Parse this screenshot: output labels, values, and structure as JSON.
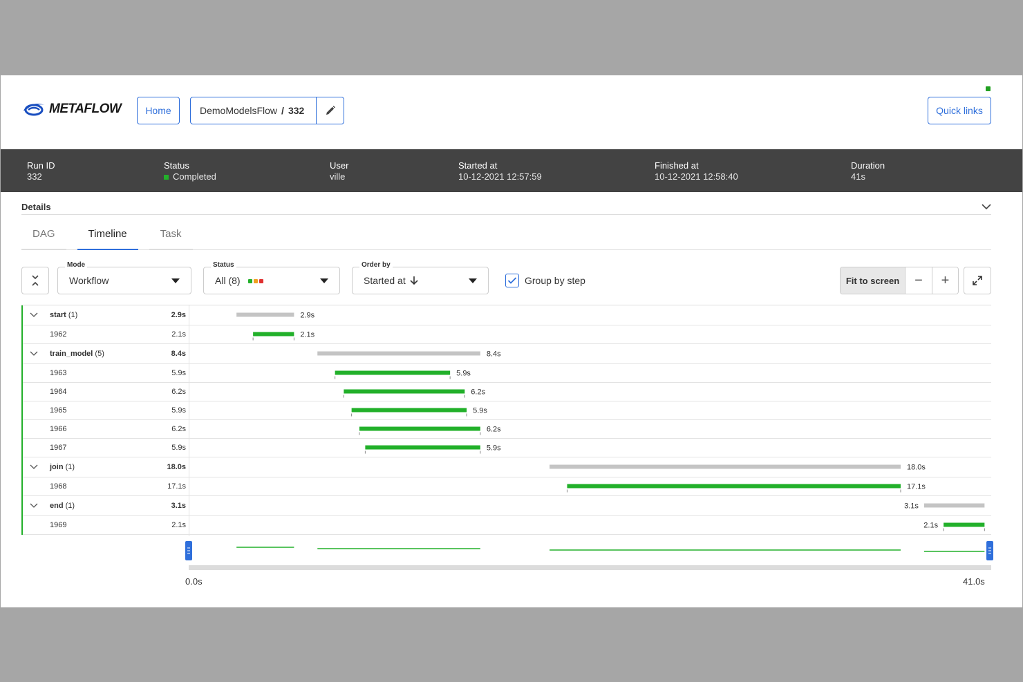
{
  "header": {
    "logo_text": "METAFLOW",
    "home_label": "Home",
    "flow_name": "DemoModelsFlow",
    "separator": "/",
    "run_number": "332",
    "quick_links_label": "Quick links"
  },
  "summary": {
    "run_id_label": "Run ID",
    "run_id": "332",
    "status_label": "Status",
    "status": "Completed",
    "user_label": "User",
    "user": "ville",
    "started_label": "Started at",
    "started": "10-12-2021 12:57:59",
    "finished_label": "Finished at",
    "finished": "10-12-2021 12:58:40",
    "duration_label": "Duration",
    "duration": "41s"
  },
  "details_label": "Details",
  "tabs": [
    {
      "label": "DAG",
      "active": false
    },
    {
      "label": "Timeline",
      "active": true
    },
    {
      "label": "Task",
      "active": false
    }
  ],
  "controls": {
    "mode_label": "Mode",
    "mode_value": "Workflow",
    "status_label": "Status",
    "status_value": "All (8)",
    "status_colors": [
      "#22b02a",
      "#f0a020",
      "#e03030"
    ],
    "order_label": "Order by",
    "order_value": "Started at",
    "group_by_label": "Group by step",
    "group_by_checked": true,
    "fit_label": "Fit to screen",
    "zoom_out": "−",
    "zoom_in": "+"
  },
  "colors": {
    "success": "#22b02a",
    "step_bar": "#c4c4c4",
    "accent": "#2f6fdb"
  },
  "timeline": {
    "total": 41.0,
    "min_label": "0.0s",
    "max_label": "41.0s",
    "rows": [
      {
        "type": "step",
        "name": "start",
        "count": "(1)",
        "duration": "2.9s",
        "start": 2.45,
        "end": 5.4,
        "label": "2.9s",
        "label_side": "right"
      },
      {
        "type": "task",
        "name": "1962",
        "duration": "2.1s",
        "start": 3.3,
        "end": 5.4,
        "label": "2.1s",
        "label_side": "right"
      },
      {
        "type": "step",
        "name": "train_model",
        "count": "(5)",
        "duration": "8.4s",
        "start": 6.6,
        "end": 14.95,
        "label": "8.4s",
        "label_side": "right"
      },
      {
        "type": "task",
        "name": "1963",
        "duration": "5.9s",
        "start": 7.5,
        "end": 13.4,
        "label": "5.9s",
        "label_side": "right"
      },
      {
        "type": "task",
        "name": "1964",
        "duration": "6.2s",
        "start": 7.95,
        "end": 14.15,
        "label": "6.2s",
        "label_side": "right"
      },
      {
        "type": "task",
        "name": "1965",
        "duration": "5.9s",
        "start": 8.35,
        "end": 14.25,
        "label": "5.9s",
        "label_side": "right"
      },
      {
        "type": "task",
        "name": "1966",
        "duration": "6.2s",
        "start": 8.75,
        "end": 14.95,
        "label": "6.2s",
        "label_side": "right"
      },
      {
        "type": "task",
        "name": "1967",
        "duration": "5.9s",
        "start": 9.05,
        "end": 14.95,
        "label": "5.9s",
        "label_side": "right"
      },
      {
        "type": "step",
        "name": "join",
        "count": "(1)",
        "duration": "18.0s",
        "start": 18.5,
        "end": 36.5,
        "label": "18.0s",
        "label_side": "right"
      },
      {
        "type": "task",
        "name": "1968",
        "duration": "17.1s",
        "start": 19.4,
        "end": 36.5,
        "label": "17.1s",
        "label_side": "right"
      },
      {
        "type": "step",
        "name": "end",
        "count": "(1)",
        "duration": "3.1s",
        "start": 37.7,
        "end": 40.8,
        "label": "3.1s",
        "label_side": "left"
      },
      {
        "type": "task",
        "name": "1969",
        "duration": "2.1s",
        "start": 38.7,
        "end": 40.8,
        "label": "2.1s",
        "label_side": "left"
      }
    ]
  }
}
